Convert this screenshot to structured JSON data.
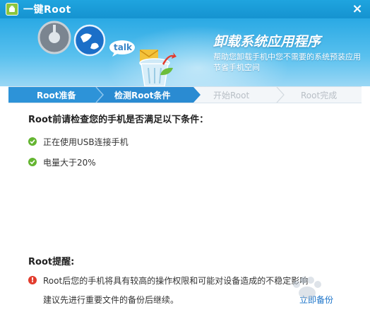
{
  "window": {
    "title": "一键Root",
    "close_label": "×"
  },
  "banner": {
    "title": "卸载系统应用程序",
    "subtitle": "帮助您卸载手机中您不需要的系统预装应用节省手机空间",
    "talk_label": "talk"
  },
  "steps": [
    {
      "label": "Root准备",
      "state": "done"
    },
    {
      "label": "检测Root条件",
      "state": "current"
    },
    {
      "label": "开始Root",
      "state": "todo"
    },
    {
      "label": "Root完成",
      "state": "todo"
    }
  ],
  "check": {
    "heading": "Root前请检查您的手机是否满足以下条件：",
    "items": [
      {
        "text": "正在使用USB连接手机"
      },
      {
        "text": "电量大于20%"
      }
    ]
  },
  "reminder": {
    "title": "Root提醒:",
    "line1": "Root后您的手机将具有较高的操作权限和可能对设备造成的不稳定影响",
    "line2": "建议先进行重要文件的备份后继续。",
    "backup_link": "立即备份"
  },
  "colors": {
    "titlebar": "#1593d0",
    "step_active": "#2b8fd6",
    "check_green": "#64b531",
    "warn_red": "#e23c2d",
    "link_blue": "#1a73c9"
  }
}
